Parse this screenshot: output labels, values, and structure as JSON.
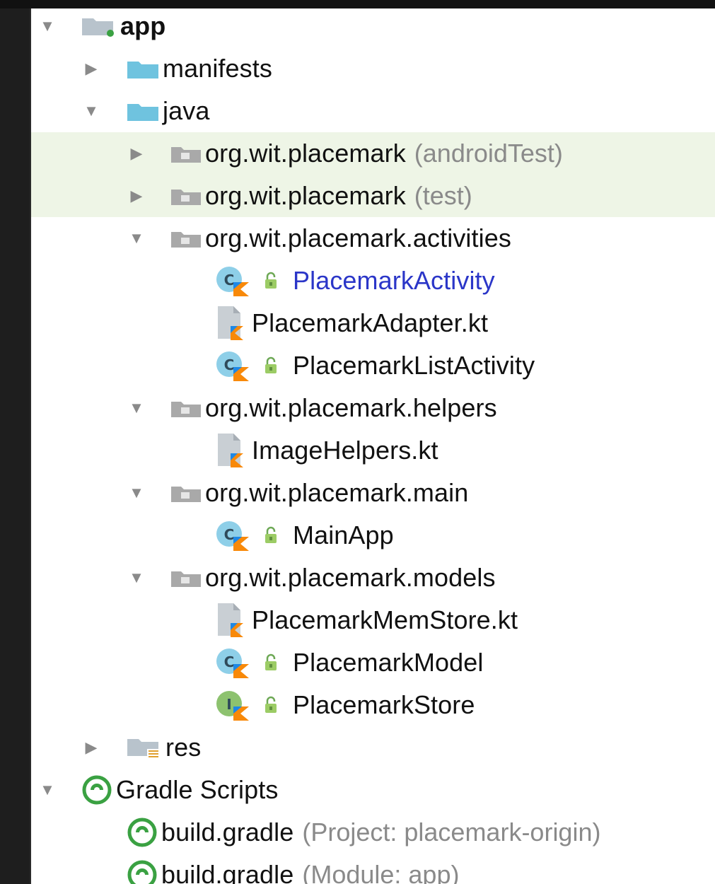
{
  "tree": [
    {
      "id": "app",
      "label": "app",
      "arrow": "down",
      "indent": 0,
      "icon": "module-folder-icon",
      "bold": true
    },
    {
      "id": "manifests",
      "label": "manifests",
      "arrow": "right",
      "indent": 1,
      "icon": "folder-icon"
    },
    {
      "id": "java",
      "label": "java",
      "arrow": "down",
      "indent": 1,
      "icon": "folder-icon"
    },
    {
      "id": "pkg-androidtest",
      "label": "org.wit.placemark",
      "suffix": "(androidTest)",
      "arrow": "right",
      "indent": 2,
      "icon": "package-icon",
      "highlight": true
    },
    {
      "id": "pkg-test",
      "label": "org.wit.placemark",
      "suffix": "(test)",
      "arrow": "right",
      "indent": 2,
      "icon": "package-icon",
      "highlight": true
    },
    {
      "id": "pkg-activities",
      "label": "org.wit.placemark.activities",
      "arrow": "down",
      "indent": 2,
      "icon": "package-icon"
    },
    {
      "id": "placemark-activity",
      "label": "PlacemarkActivity",
      "indent": 3,
      "icon": "kotlin-class-icon",
      "lock": true,
      "blue": true
    },
    {
      "id": "placemark-adapter",
      "label": "PlacemarkAdapter.kt",
      "indent": 3,
      "icon": "kotlin-file-icon"
    },
    {
      "id": "placemark-list-activity",
      "label": "PlacemarkListActivity",
      "indent": 3,
      "icon": "kotlin-class-icon",
      "lock": true
    },
    {
      "id": "pkg-helpers",
      "label": "org.wit.placemark.helpers",
      "arrow": "down",
      "indent": 2,
      "icon": "package-icon"
    },
    {
      "id": "image-helpers",
      "label": "ImageHelpers.kt",
      "indent": 3,
      "icon": "kotlin-file-icon"
    },
    {
      "id": "pkg-main",
      "label": "org.wit.placemark.main",
      "arrow": "down",
      "indent": 2,
      "icon": "package-icon"
    },
    {
      "id": "main-app",
      "label": "MainApp",
      "indent": 3,
      "icon": "kotlin-class-icon",
      "lock": true
    },
    {
      "id": "pkg-models",
      "label": "org.wit.placemark.models",
      "arrow": "down",
      "indent": 2,
      "icon": "package-icon"
    },
    {
      "id": "placemark-memstore",
      "label": "PlacemarkMemStore.kt",
      "indent": 3,
      "icon": "kotlin-file-icon"
    },
    {
      "id": "placemark-model",
      "label": "PlacemarkModel",
      "indent": 3,
      "icon": "kotlin-class-icon",
      "lock": true
    },
    {
      "id": "placemark-store",
      "label": "PlacemarkStore",
      "indent": 3,
      "icon": "kotlin-interface-icon",
      "lock": true
    },
    {
      "id": "res",
      "label": "res",
      "arrow": "right",
      "indent": 1,
      "icon": "res-folder-icon"
    },
    {
      "id": "gradle-scripts",
      "label": "Gradle Scripts",
      "arrow": "down",
      "indent": 0,
      "icon": "gradle-icon"
    },
    {
      "id": "build-gradle-project",
      "label": "build.gradle",
      "suffix": "(Project: placemark-origin)",
      "indent": 1,
      "icon": "gradle-icon"
    },
    {
      "id": "build-gradle-module",
      "label": "build.gradle",
      "suffix": "(Module: app)",
      "indent": 1,
      "icon": "gradle-icon"
    }
  ],
  "colors": {
    "highlight": "#eef5e6",
    "folder": "#6fc3df",
    "package": "#a9a9a9",
    "kotlin_orange": "#f88909",
    "kotlin_blue": "#1e88e5",
    "class_bubble": "#8ecfe8",
    "interface_bubble": "#8dc26f",
    "gradle": "#3aa142",
    "blue_text": "#2b36c8"
  }
}
